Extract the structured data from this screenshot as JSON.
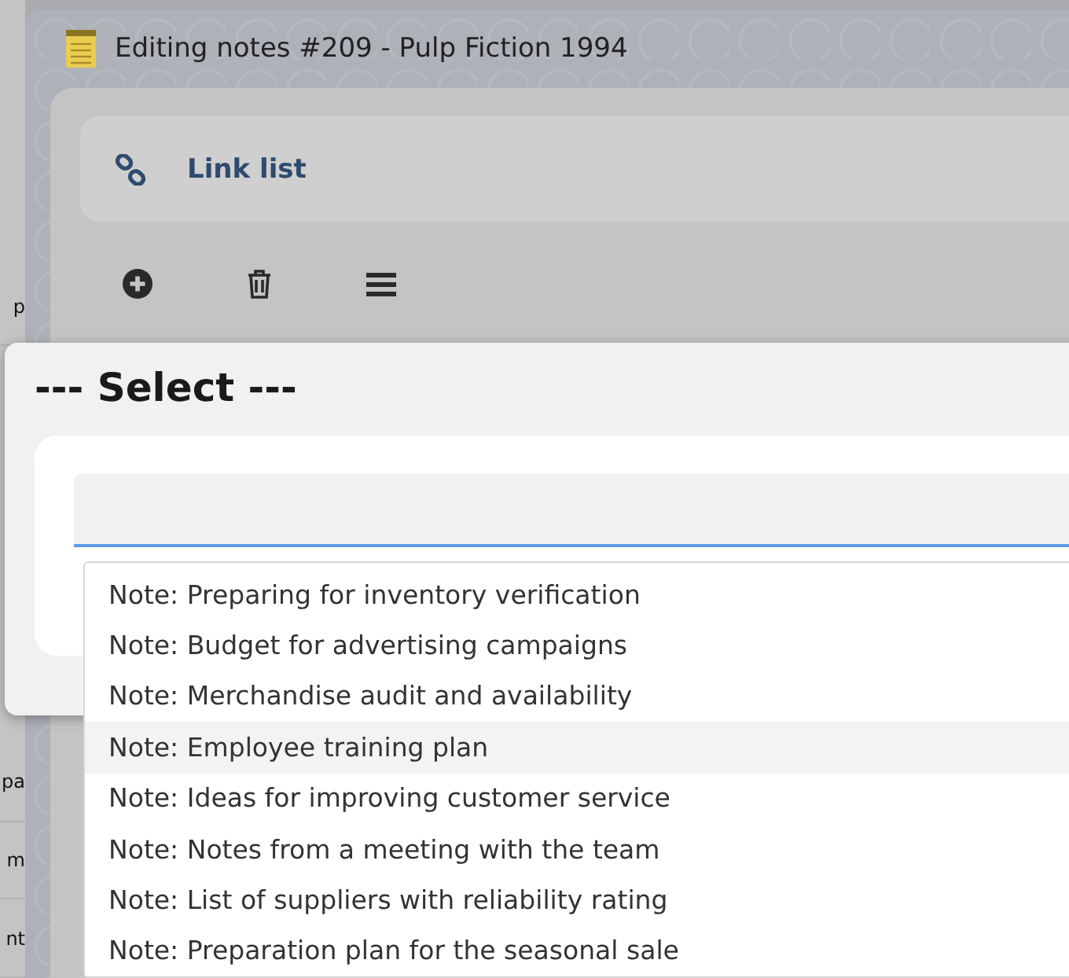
{
  "background_fragments_top": [
    "p"
  ],
  "background_fragments_bottom": [
    "pa",
    "m",
    "nt"
  ],
  "window": {
    "title": "Editing notes #209 - Pulp Fiction 1994"
  },
  "section": {
    "title": "Link list"
  },
  "dialog": {
    "title": "--- Select ---",
    "search": {
      "focused": true
    },
    "options": [
      {
        "label": "Note: Preparing for inventory verification",
        "selected": false
      },
      {
        "label": "Note: Budget for advertising campaigns",
        "selected": false
      },
      {
        "label": "Note: Merchandise audit and availability",
        "selected": false
      },
      {
        "label": "Note: Employee training plan",
        "selected": true
      },
      {
        "label": "Note: Ideas for improving customer service",
        "selected": false
      },
      {
        "label": "Note: Notes from a meeting with the team",
        "selected": false
      },
      {
        "label": "Note: List of suppliers with reliability rating",
        "selected": false
      },
      {
        "label": "Note: Preparation plan for the seasonal sale",
        "selected": false
      }
    ]
  }
}
